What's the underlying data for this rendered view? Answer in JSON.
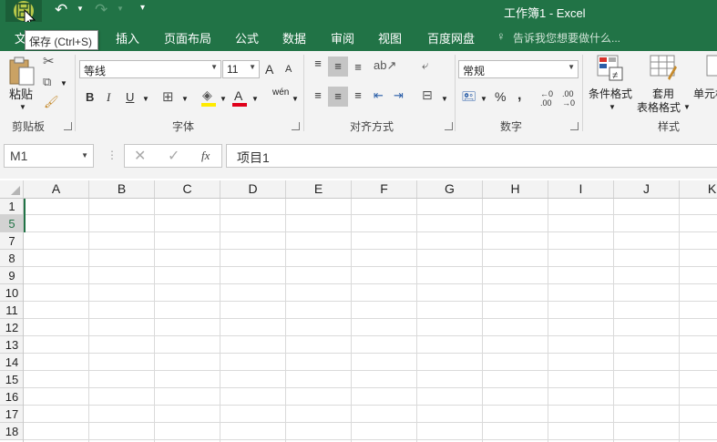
{
  "title_bar": {
    "title": "工作簿1 - Excel"
  },
  "tooltip": "保存 (Ctrl+S)",
  "tabs": [
    {
      "label": "文"
    },
    {
      "label": "插入"
    },
    {
      "label": "页面布局"
    },
    {
      "label": "公式"
    },
    {
      "label": "数据"
    },
    {
      "label": "审阅"
    },
    {
      "label": "视图"
    },
    {
      "label": "百度网盘"
    }
  ],
  "tell_me": "告诉我您想要做什么...",
  "ribbon": {
    "clipboard": {
      "paste_label": "粘贴",
      "group_label": "剪贴板"
    },
    "font": {
      "font_name": "等线",
      "font_size": "11",
      "group_label": "字体",
      "bold": "B",
      "italic": "I",
      "underline": "U",
      "wen": "wén",
      "grow": "A",
      "shrink": "A",
      "color_a": "A"
    },
    "alignment": {
      "group_label": "对齐方式"
    },
    "number": {
      "format": "常规",
      "group_label": "数字",
      "percent": "%",
      "comma": ","
    },
    "styles": {
      "cond_format": "条件格式",
      "table_format_1": "套用",
      "table_format_2": "表格格式",
      "cell_styles": "单元格",
      "group_label": "样式"
    }
  },
  "formula_bar": {
    "name_box": "M1",
    "formula": "项目1",
    "fx": "fx"
  },
  "grid": {
    "columns": [
      "A",
      "B",
      "C",
      "D",
      "E",
      "F",
      "G",
      "H",
      "I",
      "J",
      "K"
    ],
    "rows": [
      "1",
      "5",
      "7",
      "8",
      "9",
      "10",
      "11",
      "12",
      "13",
      "14",
      "15",
      "16",
      "17",
      "18"
    ],
    "selected_row": "5"
  },
  "colors": {
    "accent": "#217346",
    "ribbon_bg": "#f3f3f3"
  }
}
